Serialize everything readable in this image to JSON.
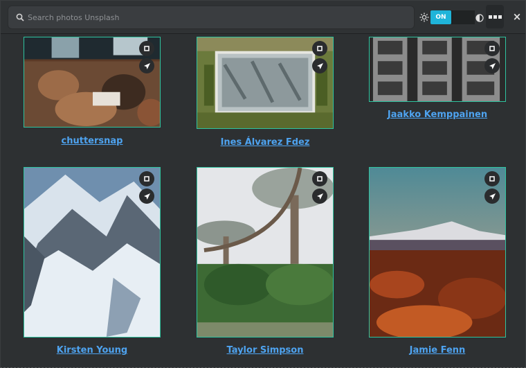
{
  "search": {
    "placeholder": "Search photos Unsplash",
    "value": ""
  },
  "theme_toggle": {
    "state_label": "ON"
  },
  "window": {
    "close_label": "×"
  },
  "photos": [
    {
      "author": "chuttersnap"
    },
    {
      "author": "Ines Álvarez Fdez"
    },
    {
      "author": "Jaakko Kemppainen"
    },
    {
      "author": "Kirsten Young"
    },
    {
      "author": "Taylor Simpson"
    },
    {
      "author": "Jamie Fenn"
    }
  ],
  "icons": {
    "search": "magnifier-icon",
    "sun": "sun-icon",
    "moon": "half-moon-icon",
    "menu": "menu-dots-icon",
    "close": "close-icon",
    "set_wallpaper": "square-icon",
    "share": "paper-plane-icon"
  },
  "colors": {
    "background": "#2d3032",
    "accent": "#1fb4d9",
    "link": "#4ea3f0",
    "photo_border": "#2ec4a0"
  }
}
